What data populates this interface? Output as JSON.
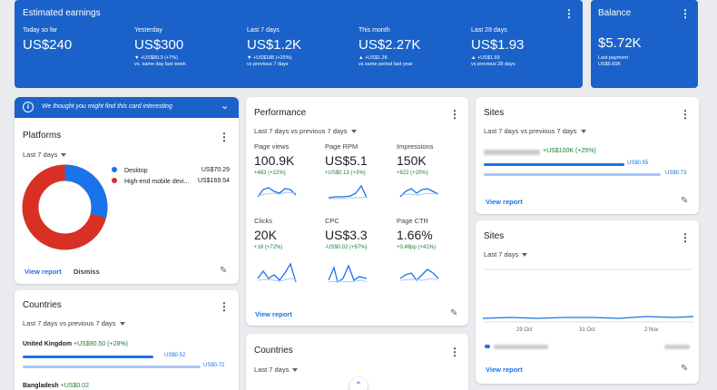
{
  "earnings": {
    "title": "Estimated earnings",
    "items": [
      {
        "label": "Today so far",
        "value": "US$240",
        "delta": "",
        "note": ""
      },
      {
        "label": "Yesterday",
        "value": "US$300",
        "delta": "▼ +US$80.3 (+7%)",
        "note": "vs. same day last week"
      },
      {
        "label": "Last 7 days",
        "value": "US$1.2K",
        "delta": "▼ +US$188 (+25%)",
        "note": "vs previous 7 days"
      },
      {
        "label": "This month",
        "value": "US$2.27K",
        "delta": "▲ +US$1.2K",
        "note": "vs same period last year"
      },
      {
        "label": "Last 28 days",
        "value": "US$1.93",
        "delta": "▲ +US$1.93",
        "note": "vs previous 28 days"
      }
    ]
  },
  "balance": {
    "title": "Balance",
    "value": "$5.72K",
    "note_label": "Last payment",
    "note_value": "US$6.60K"
  },
  "tip": {
    "text": "We thought you might find this card interesting"
  },
  "platforms": {
    "title": "Platforms",
    "range": "Last 7 days",
    "legend": [
      {
        "name": "Desktop",
        "value": "US$70.29",
        "color": "#1a73e8"
      },
      {
        "name": "High-end mobile devi...",
        "value": "US$169.54",
        "color": "#d93025"
      }
    ],
    "donut": {
      "desktop_fraction": 0.29
    },
    "view_report": "View report",
    "dismiss": "Dismiss"
  },
  "countries_left": {
    "title": "Countries",
    "range": "Last 7 days vs previous 7 days",
    "rows": [
      {
        "name": "United Kingdom",
        "delta": "+US$90.50 (+28%)",
        "current": "US$0.52",
        "previous": "US$0.72",
        "current_fraction": 0.72,
        "previous_fraction": 0.98
      },
      {
        "name": "Bangladesh",
        "delta": "+US$0.02",
        "current": "",
        "previous": "",
        "current_fraction": 0,
        "previous_fraction": 0
      }
    ]
  },
  "performance": {
    "title": "Performance",
    "range": "Last 7 days vs previous 7 days",
    "metrics": [
      {
        "label": "Page views",
        "value": "100.9K",
        "delta": "+463 (+22%)"
      },
      {
        "label": "Page RPM",
        "value": "US$5.1",
        "delta": "+US$0.13 (+3%)"
      },
      {
        "label": "Impressions",
        "value": "150K",
        "delta": "+622 (+20%)"
      },
      {
        "label": "Clicks",
        "value": "20K",
        "delta": "+18 (+72%)"
      },
      {
        "label": "CPC",
        "value": "US$3.3",
        "delta": "-US$0.02 (+67%)"
      },
      {
        "label": "Page CTR",
        "value": "1.66%",
        "delta": "+0.49pp (+41%)"
      }
    ],
    "view_report": "View report"
  },
  "countries_mid": {
    "title": "Countries",
    "range": "Last 7 days"
  },
  "sites1": {
    "title": "Sites",
    "range": "Last 7 days vs previous 7 days",
    "delta": "+US$100K (+25%)",
    "current": "US$0.55",
    "previous": "US$0.73",
    "current_fraction": 0.7,
    "previous_fraction": 0.88,
    "view_report": "View report"
  },
  "sites2": {
    "title": "Sites",
    "range": "Last 7 days",
    "x_labels": [
      "29 Oct",
      "31 Oct",
      "2 Nov"
    ],
    "view_report": "View report"
  },
  "colors": {
    "brand_blue": "#1a62c9",
    "accent_blue": "#1a73e8",
    "light_blue": "#a8c7fa",
    "green": "#188038",
    "red": "#d93025"
  }
}
